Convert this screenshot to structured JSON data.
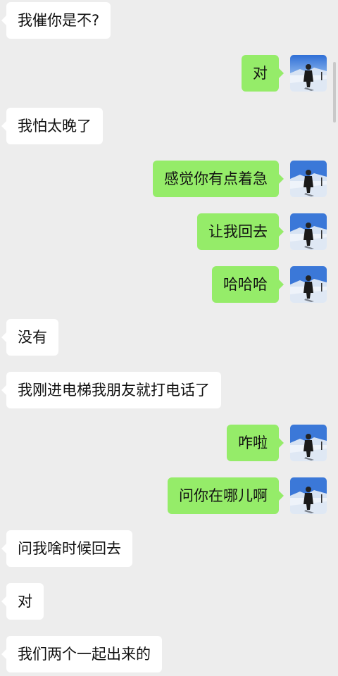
{
  "colors": {
    "background": "#ededed",
    "incoming_bubble": "#ffffff",
    "outgoing_bubble": "#95ec69"
  },
  "avatar_icon": "snowfield-person-avatar",
  "messages": [
    {
      "side": "in",
      "text": "我催你是不?"
    },
    {
      "side": "out",
      "text": "对"
    },
    {
      "side": "in",
      "text": "我怕太晚了"
    },
    {
      "side": "out",
      "text": "感觉你有点着急"
    },
    {
      "side": "out",
      "text": "让我回去"
    },
    {
      "side": "out",
      "text": "哈哈哈"
    },
    {
      "side": "in",
      "text": "没有"
    },
    {
      "side": "in",
      "text": "我刚进电梯我朋友就打电话了"
    },
    {
      "side": "out",
      "text": "咋啦"
    },
    {
      "side": "out",
      "text": "问你在哪儿啊"
    },
    {
      "side": "in",
      "text": "问我啥时候回去"
    },
    {
      "side": "in",
      "text": "对"
    },
    {
      "side": "in",
      "text": "我们两个一起出来的"
    }
  ]
}
